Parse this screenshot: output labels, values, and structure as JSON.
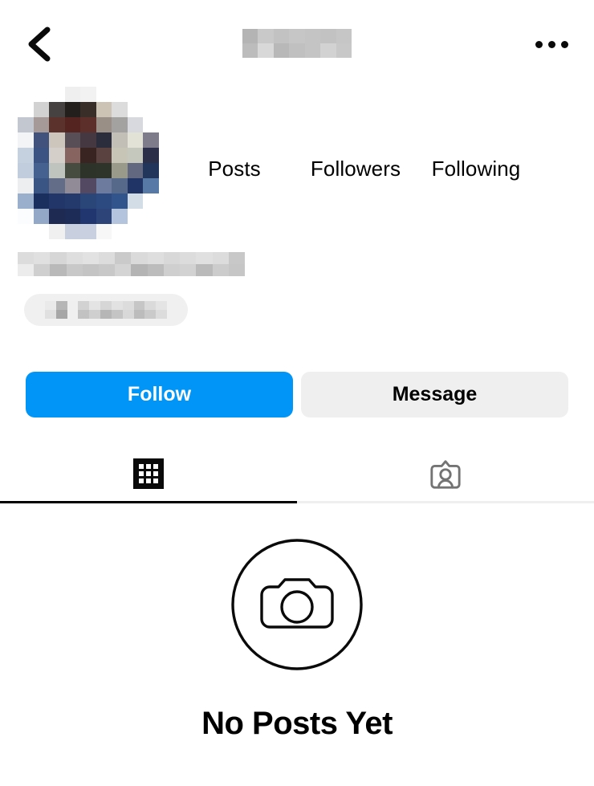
{
  "header": {
    "back_icon": "chevron-left-icon",
    "username_redacted": true,
    "menu_icon": "more-options-icon"
  },
  "profile": {
    "avatar_redacted": true,
    "name_redacted": true,
    "category_badge_redacted": true,
    "stats": [
      {
        "label": "Posts",
        "value": ""
      },
      {
        "label": "Followers",
        "value": ""
      },
      {
        "label": "Following",
        "value": ""
      }
    ]
  },
  "actions": {
    "follow_label": "Follow",
    "message_label": "Message"
  },
  "tabs": [
    {
      "name": "grid",
      "icon": "grid-icon",
      "active": true
    },
    {
      "name": "tagged",
      "icon": "tagged-person-icon",
      "active": false
    }
  ],
  "empty_state": {
    "icon": "camera-icon",
    "title": "No Posts Yet"
  },
  "colors": {
    "accent_blue": "#0095F6",
    "button_gray": "#EFEFEF",
    "badge_gray": "#F0F0F0",
    "text_black": "#000000",
    "inactive_gray": "#737373"
  }
}
